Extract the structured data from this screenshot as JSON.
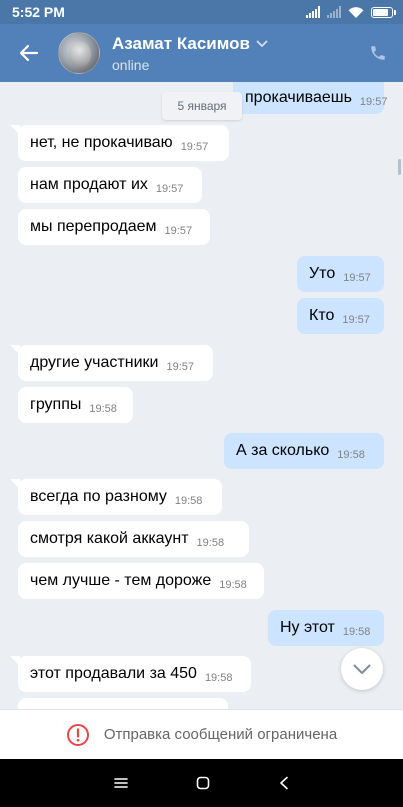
{
  "status_bar": {
    "time": "5:52 PM",
    "battery_level": 0.75
  },
  "header": {
    "contact_name": "Азамат Касимов",
    "contact_status": "online"
  },
  "colors": {
    "header_bg": "#5181b8",
    "status_bar_bg": "#4a76a8",
    "incoming_bubble": "#ffffff",
    "outgoing_bubble": "#cce4ff",
    "chat_bg": "#ebeef2",
    "restriction_icon": "#e64646"
  },
  "date_separator": "5 января",
  "messages": [
    {
      "text": "прокачиваешь",
      "time": "19:57",
      "dir": "out"
    },
    {
      "text": "нет, не прокачиваю",
      "time": "19:57",
      "dir": "in"
    },
    {
      "text": "нам продают их",
      "time": "19:57",
      "dir": "in"
    },
    {
      "text": "мы перепродаем",
      "time": "19:57",
      "dir": "in"
    },
    {
      "text": "Уто",
      "time": "19:57",
      "dir": "out"
    },
    {
      "text": "Кто",
      "time": "19:57",
      "dir": "out"
    },
    {
      "text": "другие участники",
      "time": "19:57",
      "dir": "in"
    },
    {
      "text": "группы",
      "time": "19:58",
      "dir": "in"
    },
    {
      "text": "А за сколько",
      "time": "19:58",
      "dir": "out"
    },
    {
      "text": "всегда по разному",
      "time": "19:58",
      "dir": "in"
    },
    {
      "text": "смотря какой аккаунт",
      "time": "19:58",
      "dir": "in"
    },
    {
      "text": "чем лучше - тем дороже",
      "time": "19:58",
      "dir": "in"
    },
    {
      "text": "Ну этот",
      "time": "19:58",
      "dir": "out"
    },
    {
      "text": "этот продавали за 450",
      "time": "19:58",
      "dir": "in"
    }
  ],
  "restriction": {
    "text": "Отправка сообщений ограничена",
    "icon": "alert-circle-icon"
  },
  "nav": {
    "icons": [
      "menu-icon",
      "home-icon",
      "back-icon"
    ]
  }
}
